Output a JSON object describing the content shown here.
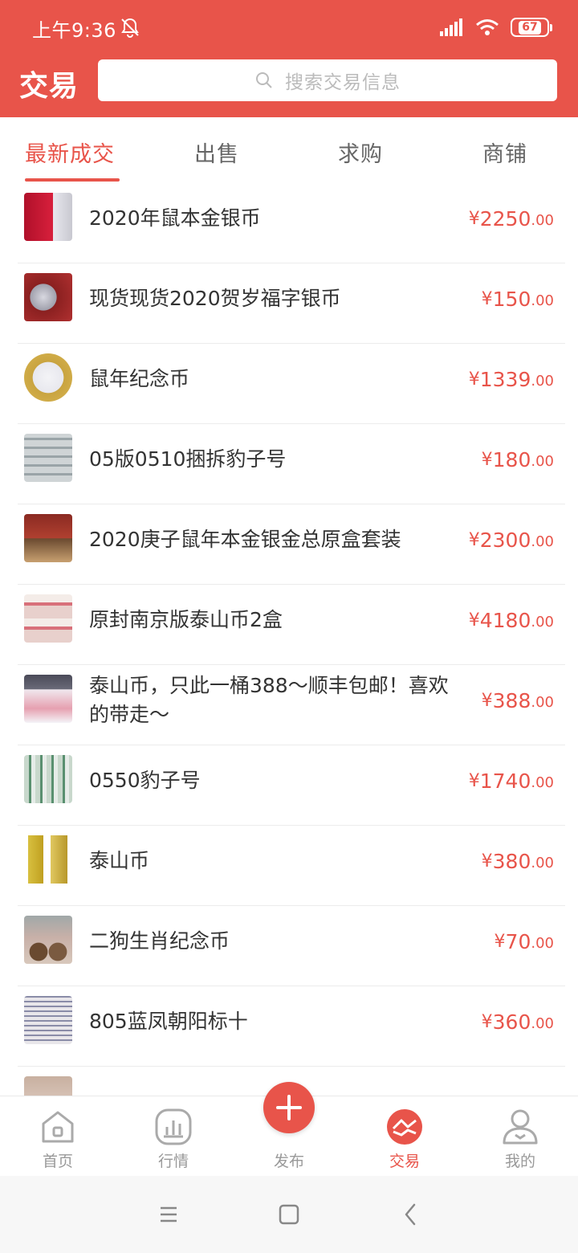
{
  "status_bar": {
    "time": "上午9:36",
    "battery": "67",
    "icons": [
      "bell-off-icon",
      "signal-icon",
      "wifi-icon",
      "battery-icon"
    ]
  },
  "app_bar": {
    "title": "交易",
    "search_placeholder": "搜索交易信息"
  },
  "tabs": [
    {
      "label": "最新成交",
      "active": true
    },
    {
      "label": "出售",
      "active": false
    },
    {
      "label": "求购",
      "active": false
    },
    {
      "label": "商铺",
      "active": false
    }
  ],
  "list": [
    {
      "title": "2020年鼠本金银币",
      "price_currency": "¥",
      "price_int": "2250",
      "price_dec": ".00"
    },
    {
      "title": "现货现货2020贺岁福字银币",
      "price_currency": "¥",
      "price_int": "150",
      "price_dec": ".00"
    },
    {
      "title": "鼠年纪念币",
      "price_currency": "¥",
      "price_int": "1339",
      "price_dec": ".00"
    },
    {
      "title": "05版0510捆拆豹子号",
      "price_currency": "¥",
      "price_int": "180",
      "price_dec": ".00"
    },
    {
      "title": "2020庚子鼠年本金银金总原盒套装",
      "price_currency": "¥",
      "price_int": "2300",
      "price_dec": ".00"
    },
    {
      "title": "原封南京版泰山币2盒",
      "price_currency": "¥",
      "price_int": "4180",
      "price_dec": ".00"
    },
    {
      "title": "泰山币，只此一桶388～顺丰包邮！喜欢的带走～",
      "price_currency": "¥",
      "price_int": "388",
      "price_dec": ".00"
    },
    {
      "title": "0550豹子号",
      "price_currency": "¥",
      "price_int": "1740",
      "price_dec": ".00"
    },
    {
      "title": "泰山币",
      "price_currency": "¥",
      "price_int": "380",
      "price_dec": ".00"
    },
    {
      "title": "二狗生肖纪念币",
      "price_currency": "¥",
      "price_int": "70",
      "price_dec": ".00"
    },
    {
      "title": "805蓝凤朝阳标十",
      "price_currency": "¥",
      "price_int": "360",
      "price_dec": ".00"
    }
  ],
  "bottom_nav": [
    {
      "label": "首页",
      "icon": "home-icon",
      "active": false
    },
    {
      "label": "行情",
      "icon": "chart-icon",
      "active": false
    },
    {
      "label": "发布",
      "icon": "plus-icon",
      "active": false
    },
    {
      "label": "交易",
      "icon": "trade-icon",
      "active": true
    },
    {
      "label": "我的",
      "icon": "user-icon",
      "active": false
    }
  ],
  "colors": {
    "brand": "#e8544a",
    "text": "#333333",
    "muted": "#999999"
  }
}
